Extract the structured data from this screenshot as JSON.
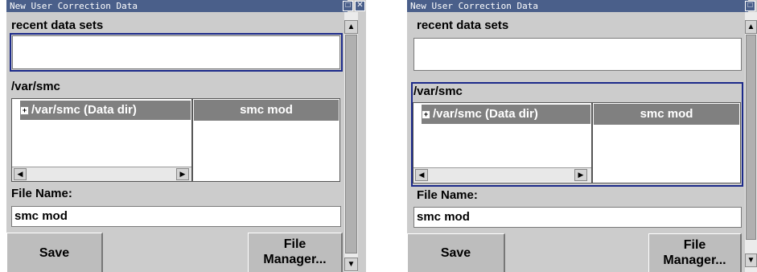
{
  "dialogs": [
    {
      "title": "New User Correction Data",
      "recent_label": "recent data sets",
      "path_label": "/var/smc",
      "tree_item": "/var/smc (Data dir)",
      "file_list_item": "smc mod",
      "file_name_label": "File Name:",
      "file_name_value": "smc mod",
      "save_label": "Save",
      "file_manager_label_1": "File",
      "file_manager_label_2": "Manager..."
    },
    {
      "title": "New User Correction Data",
      "recent_label": "recent data sets",
      "path_label": "/var/smc",
      "tree_item": "/var/smc (Data dir)",
      "file_list_item": "smc mod",
      "file_name_label": "File Name:",
      "file_name_value": "smc mod",
      "save_label": "Save",
      "file_manager_label_1": "File",
      "file_manager_label_2": "Manager..."
    }
  ],
  "colors": {
    "titlebar": "#4a5f8a",
    "focus_border": "#1c2a8a",
    "selected_item": "#808080"
  }
}
